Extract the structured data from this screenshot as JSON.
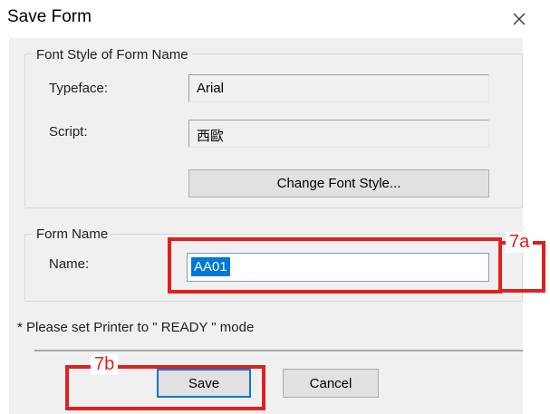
{
  "window": {
    "title": "Save Form",
    "close_glyph": "✕",
    "icon": "close-icon"
  },
  "font_style_group": {
    "title": "Font Style of Form Name",
    "typeface_label": "Typeface:",
    "typeface_value": "Arial",
    "script_label": "Script:",
    "script_value": "西歐",
    "change_button": "Change Font Style..."
  },
  "form_name_group": {
    "title": "Form Name",
    "name_label": "Name:",
    "name_value": "AA01"
  },
  "note": "* Please set Printer to \" READY \" mode",
  "buttons": {
    "save": "Save",
    "cancel": "Cancel"
  },
  "annotations": {
    "a_label": "7a",
    "b_label": "7b",
    "color": "#e02020"
  },
  "colors": {
    "selection": "#0078d7",
    "dialog_bg": "#f0f0f0",
    "focus_border": "#7a9cd3"
  }
}
